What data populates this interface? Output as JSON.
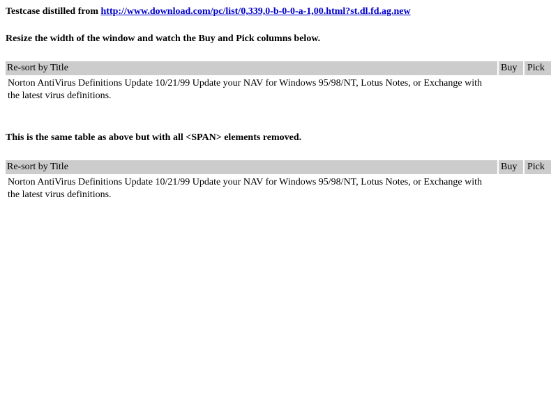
{
  "intro": {
    "prefix": "Testcase distilled from ",
    "link_text": "http://www.download.com/pc/list/0,339,0-b-0-0-a-1,00.html?st.dl.fd.ag.new"
  },
  "instruction": "Resize the width of the window and watch the Buy and Pick columns below.",
  "note": "This is the same table as above but with all <SPAN> elements removed.",
  "tables": [
    {
      "header": {
        "title": "Re-sort by Title",
        "buy": "Buy",
        "pick": "Pick"
      },
      "row": {
        "description": "Norton AntiVirus Definitions Update 10/21/99 Update your NAV for Windows 95/98/NT, Lotus Notes, or Exchange with the latest virus definitions."
      }
    },
    {
      "header": {
        "title": "Re-sort by Title",
        "buy": "Buy",
        "pick": "Pick"
      },
      "row": {
        "description": "Norton AntiVirus Definitions Update 10/21/99 Update your NAV for Windows 95/98/NT, Lotus Notes, or Exchange with the latest virus definitions."
      }
    }
  ]
}
